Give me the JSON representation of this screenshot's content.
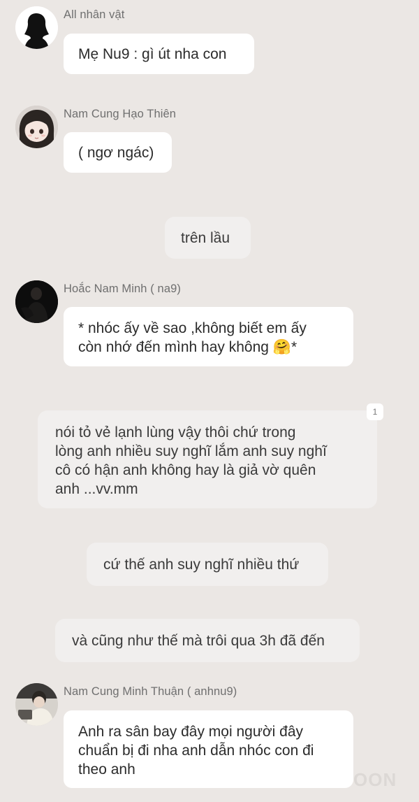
{
  "messages": [
    {
      "sender": "All nhân vật",
      "avatar": "silhouette-avatar",
      "lines": [
        "Mẹ Nu9  : gì út nha con"
      ]
    },
    {
      "sender": "Nam Cung Hạo Thiên",
      "avatar": "anime-girl-avatar",
      "lines": [
        "( ngơ ngác)"
      ]
    },
    {
      "narration": [
        "trên lầu"
      ]
    },
    {
      "sender": "Hoắc Nam Minh ( na9)",
      "avatar": "dark-photo-avatar",
      "lines": [
        "* nhóc ấy về sao ,không biết em ấy",
        "còn nhớ đến mình hay không 🤗*"
      ]
    },
    {
      "narration": [
        "nói tỏ vẻ lạnh lùng vậy thôi chứ trong",
        "lòng anh nhiều suy nghĩ lắm anh suy nghĩ",
        "cô có hận anh không hay là giả vờ quên",
        "anh ...vv.mm"
      ],
      "badge": "1"
    },
    {
      "narration": [
        "cứ thế anh suy nghĩ nhiều thứ"
      ]
    },
    {
      "narration": [
        "và cũng như thế mà trôi qua 3h đã đến"
      ]
    },
    {
      "sender": "Nam Cung Minh Thuận ( anhnu9)",
      "avatar": "boy-photo-avatar",
      "lines": [
        "Anh ra sân bay đây mọi người đây",
        "chuẩn bị đi nha anh dẫn nhóc con đi",
        "theo anh"
      ]
    }
  ],
  "watermark": "OON"
}
